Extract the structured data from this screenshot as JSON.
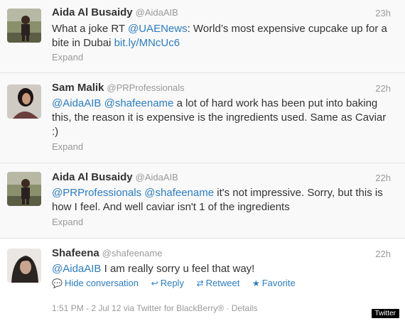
{
  "tweets": [
    {
      "name": "Aida Al Busaidy",
      "handle": "@AidaAIB",
      "time": "23h",
      "text_parts": [
        "What a joke RT ",
        "@UAENews",
        ": World’s most expensive cupcake up for a bite in Dubai ",
        "bit.ly/MNcUc6"
      ],
      "expand": "Expand"
    },
    {
      "name": "Sam Malik",
      "handle": "@PRProfessionals",
      "time": "22h",
      "text_parts": [
        "@AidaAIB",
        " ",
        "@shafeename",
        " a lot of hard work has been put into baking this, the reason it is expensive is the ingredients used. Same as Caviar :)"
      ],
      "expand": "Expand"
    },
    {
      "name": "Aida Al Busaidy",
      "handle": "@AidaAIB",
      "time": "22h",
      "text_parts": [
        "@PRProfessionals",
        " ",
        "@shafeename",
        " it's not impressive. Sorry, but this is how I feel. And well caviar isn't 1 of the ingredients"
      ],
      "expand": "Expand"
    },
    {
      "name": "Shafeena",
      "handle": "@shafeename",
      "time": "22h",
      "text_parts": [
        "@AidaAIB",
        " I am really sorry u feel that way!"
      ],
      "actions": {
        "hide": "Hide conversation",
        "reply": "Reply",
        "retweet": "Retweet",
        "favorite": "Favorite"
      },
      "footer": {
        "timestamp": "1:51 PM - 2 Jul 12 via Twitter for BlackBerry®",
        "separator": " · ",
        "details": "Details"
      }
    }
  ],
  "badge": "Twitter",
  "colors": {
    "link": "#2a7dc4",
    "muted": "#999999"
  },
  "icons": [
    "speech-bubble-icon",
    "reply-arrow-icon",
    "retweet-icon",
    "star-icon"
  ]
}
